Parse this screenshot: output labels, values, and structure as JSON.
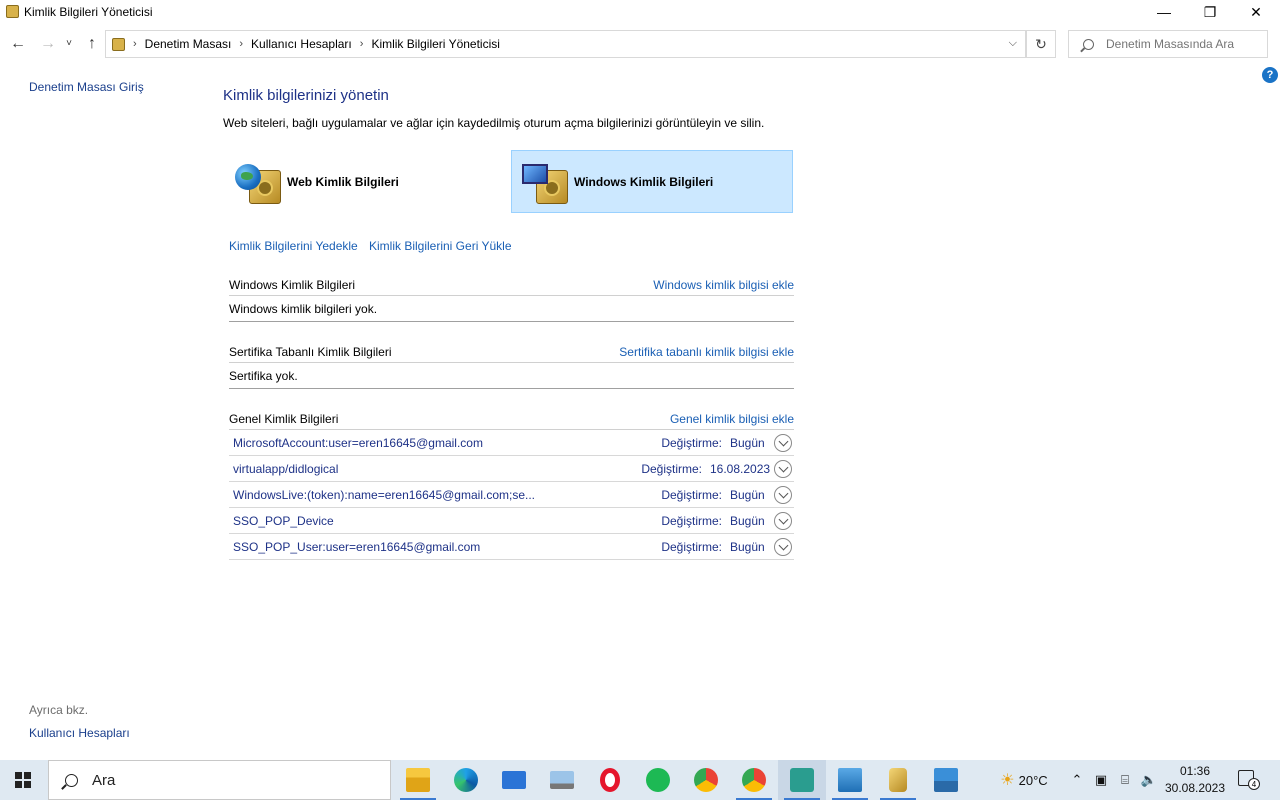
{
  "window": {
    "title": "Kimlik Bilgileri Yöneticisi",
    "minimize_glyph": "—",
    "restore_glyph": "❐",
    "close_glyph": "✕"
  },
  "address_bar": {
    "breadcrumbs": [
      "Denetim Masası",
      "Kullanıcı Hesapları",
      "Kimlik Bilgileri Yöneticisi"
    ],
    "search_placeholder": "Denetim Masasında Ara"
  },
  "left_nav": {
    "home_link": "Denetim Masası Giriş",
    "see_also_label": "Ayrıca bkz.",
    "see_also_link": "Kullanıcı Hesapları"
  },
  "main": {
    "title": "Kimlik bilgilerinizi yönetin",
    "description": "Web siteleri, bağlı uygulamalar ve ağlar için kaydedilmiş oturum açma bilgilerinizi görüntüleyin ve silin.",
    "credential_types": [
      {
        "label": "Web Kimlik Bilgileri",
        "icon": "globe-vault-icon",
        "selected": false
      },
      {
        "label": "Windows Kimlik Bilgileri",
        "icon": "monitor-vault-icon",
        "selected": true
      }
    ],
    "backup_link": "Kimlik Bilgilerini Yedekle",
    "restore_link": "Kimlik Bilgilerini Geri Yükle",
    "sections": {
      "windows": {
        "name": "Windows Kimlik Bilgileri",
        "add_link": "Windows kimlik bilgisi ekle",
        "empty_text": "Windows kimlik bilgileri yok."
      },
      "certificate": {
        "name": "Sertifika Tabanlı Kimlik Bilgileri",
        "add_link": "Sertifika tabanlı kimlik bilgisi ekle",
        "empty_text": "Sertifika yok."
      },
      "generic": {
        "name": "Genel Kimlik Bilgileri",
        "add_link": "Genel kimlik bilgisi ekle",
        "modified_label": "Değiştirme:",
        "items": [
          {
            "name": "MicrosoftAccount:user=eren16645@gmail.com",
            "modified": "Bugün"
          },
          {
            "name": "virtualapp/didlogical",
            "modified": "16.08.2023"
          },
          {
            "name": "WindowsLive:(token):name=eren16645@gmail.com;se...",
            "modified": "Bugün"
          },
          {
            "name": "SSO_POP_Device",
            "modified": "Bugün"
          },
          {
            "name": "SSO_POP_User:user=eren16645@gmail.com",
            "modified": "Bugün"
          }
        ]
      }
    }
  },
  "taskbar": {
    "search_text": "Ara",
    "weather": "20°C",
    "time": "01:36",
    "date": "30.08.2023",
    "notification_count": "4",
    "apps": [
      "file-explorer-icon",
      "edge-icon",
      "mail-icon",
      "laptop-icon",
      "opera-icon",
      "spotify-icon",
      "chrome-icon",
      "chrome-profile-icon",
      "security-app-icon",
      "control-panel-icon",
      "credential-manager-icon",
      "photos-icon"
    ]
  },
  "colors": {
    "link": "#1a5fb4",
    "heading": "#1e3287",
    "selected_bg": "#cce8ff",
    "taskbar_bg": "#dfe9f2"
  }
}
